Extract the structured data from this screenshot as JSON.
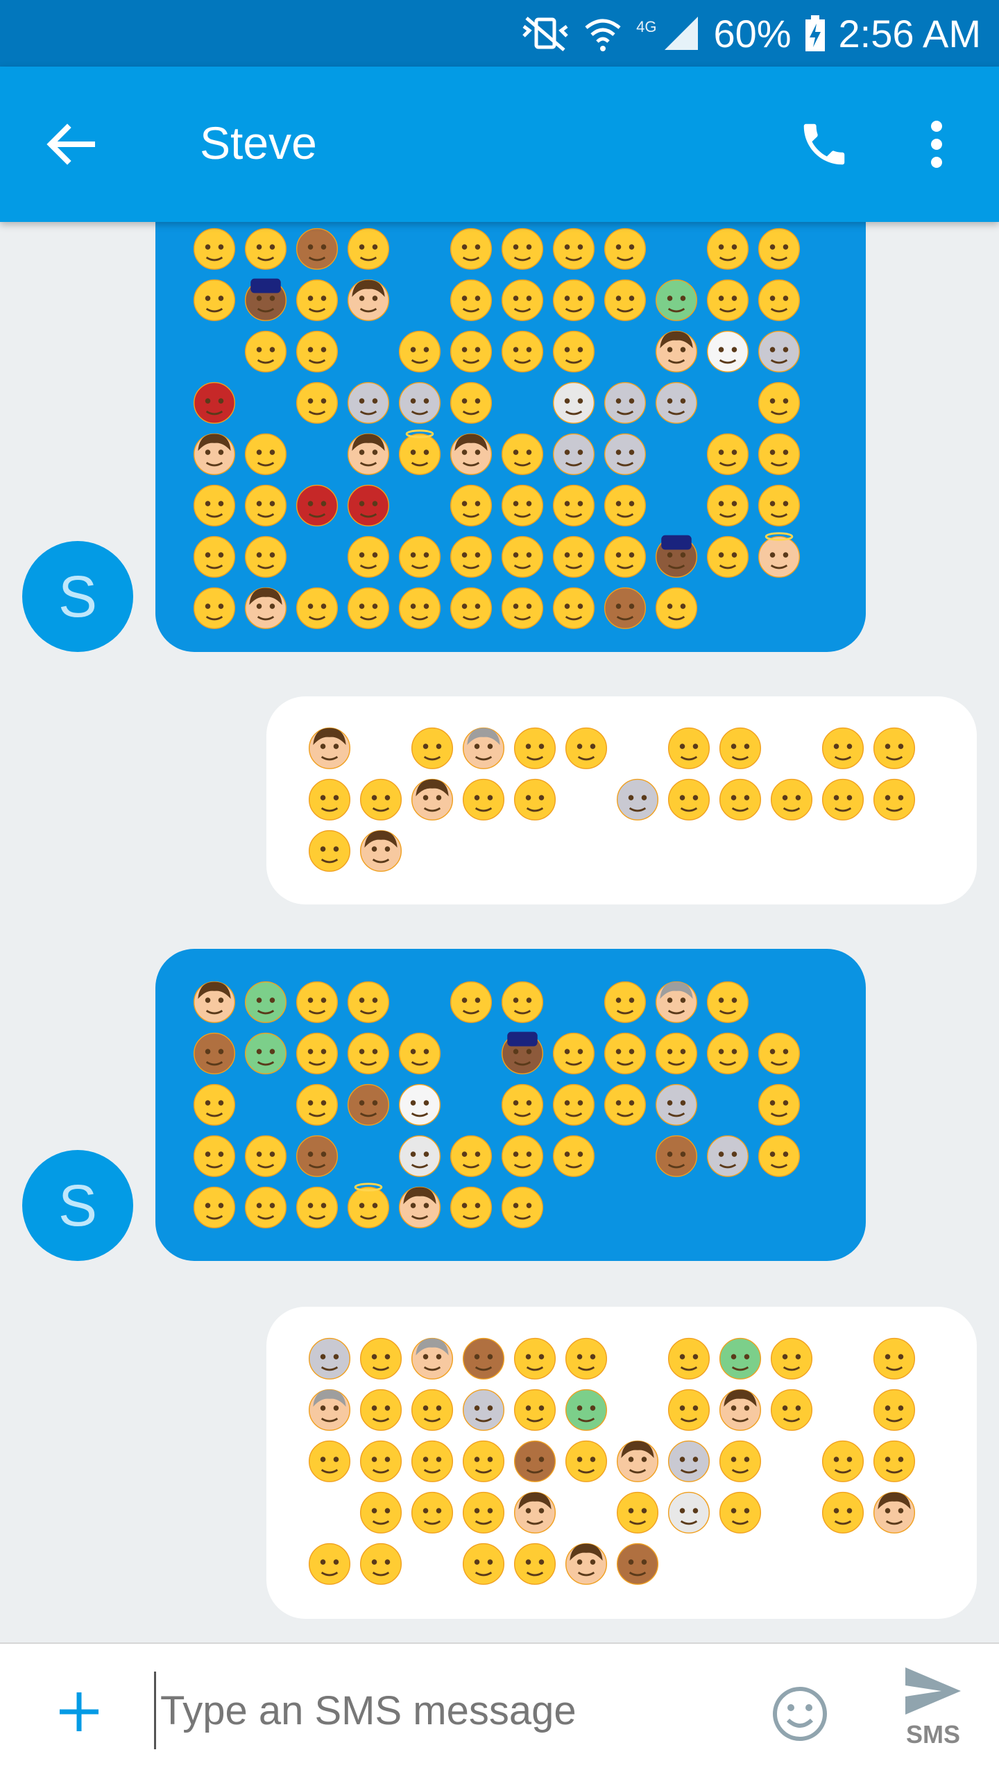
{
  "status_bar": {
    "network_label": "4G",
    "battery": "60%",
    "time": "2:56 AM"
  },
  "app_bar": {
    "contact_name": "Steve",
    "back_icon": "arrow-left-icon",
    "call_icon": "phone-icon",
    "more_icon": "more-vert-icon"
  },
  "avatar_letter": "S",
  "colors": {
    "status_bar": "#0277bd",
    "app_bar": "#039be5",
    "incoming_bubble": "#0a93e2",
    "outgoing_bubble": "#ffffff",
    "background": "#eceff1",
    "accent": "#039be5"
  },
  "messages": [
    {
      "direction": "incoming",
      "avatar": true,
      "emoji": "😲😟🙈🤔_😛😑😕😟_😧😩😵💂😘👦_😛😥😣😕👽😧😕_😂😱_😑🤓😕🤐_👦👻😿👹_😊😿😿😰_💀😾😿_🤑👦😥_👦😇👦😢😿😸_😗😡😡😲👹👹_😡🤗😊😎_😴🙄😌😴_😌😟😣😕😧😃💂😁👼😂👦😮🤓😣😕😱😟🙊😘"
    },
    {
      "direction": "outgoing",
      "avatar": false,
      "emoji": "👩_😓👵😘😕_😩😕_😘😛🙃😥👦😷😮_😻😅😟😟😣🤓😃👦"
    },
    {
      "direction": "incoming",
      "avatar": true,
      "emoji": "👩👽😵😥_😵😌_😕👵😵_🙈👽😂😂😮_💂🤕😕😱😥😛😧_😛🙊👻_🙃😱😜😾_😰😟😝🙊_💀🤐🙃😝_🙈😾🙃😊😊🙃😇👦😊😑"
    },
    {
      "direction": "outgoing",
      "avatar": false,
      "emoji": "😿😩👴🙈🤔😛_😣👽😥_😓👵😌😥😻😣👽_😣👦😜_😟😕😕😑😅🙊😣👦😾😷_😃😤_😚😜😘👦_😮💀🤐_🤑👦😊😢_🙃😢👩🙊"
    }
  ],
  "compose": {
    "add_icon": "plus-icon",
    "placeholder": "Type an SMS message",
    "emoji_icon": "smiley-icon",
    "send_icon": "send-icon",
    "send_label": "SMS"
  }
}
